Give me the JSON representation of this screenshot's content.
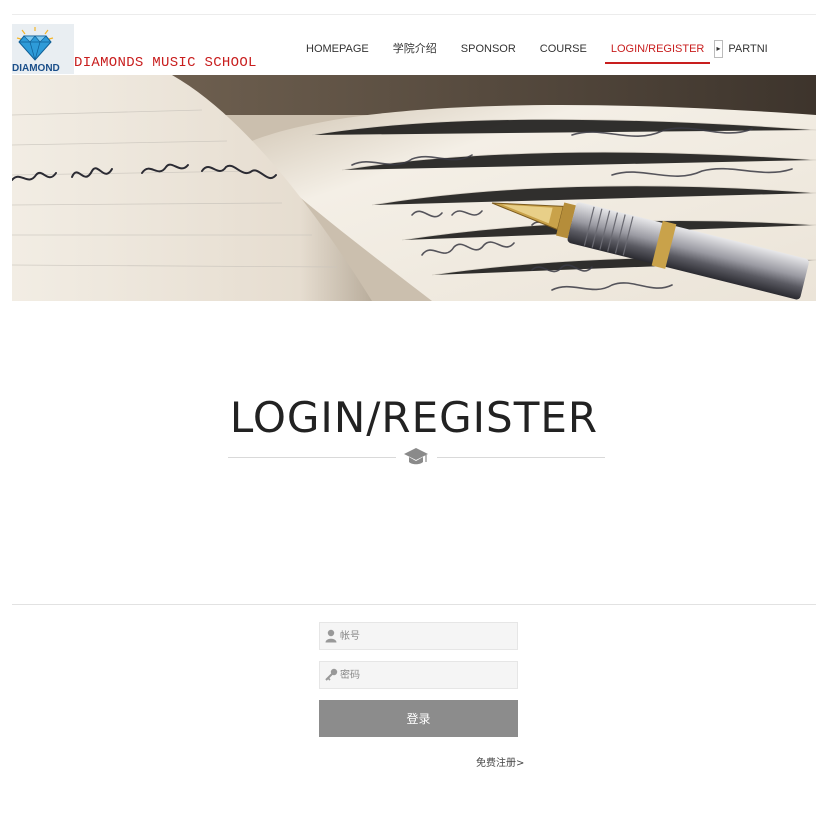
{
  "header": {
    "logo_text": "DIAMOND",
    "brand_name": "DIAMONDS MUSIC SCHOOL",
    "brand_color": "#c81e1e"
  },
  "nav": {
    "items": [
      {
        "label": "HOMEPAGE"
      },
      {
        "label": "学院介绍"
      },
      {
        "label": "SPONSOR"
      },
      {
        "label": "COURSE"
      },
      {
        "label": "LOGIN/REGISTER",
        "active": true
      },
      {
        "label": "PARTNI"
      }
    ],
    "more_icon": "triangle-right-icon"
  },
  "hero": {
    "image": "open-notebook-with-fountain-pen"
  },
  "main": {
    "title": "LOGIN/REGISTER",
    "divider_icon": "graduation-cap-icon"
  },
  "form": {
    "username_placeholder": "帐号",
    "username_value": "",
    "username_icon": "user-icon",
    "password_placeholder": "密码",
    "password_value": "",
    "password_icon": "key-icon",
    "login_label": "登录",
    "register_label": "免费注册>"
  }
}
